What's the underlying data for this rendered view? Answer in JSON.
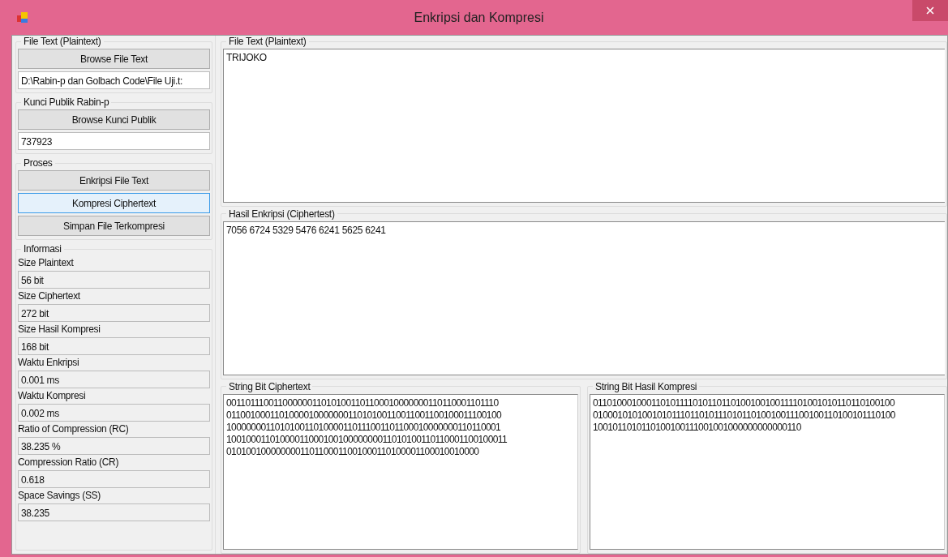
{
  "window": {
    "title": "Enkripsi dan Kompresi"
  },
  "left": {
    "file_group": {
      "title": "File Text (Plaintext)",
      "button": "Browse File Text",
      "path": "D:\\Rabin-p dan Golbach Code\\File Uji.t:"
    },
    "key_group": {
      "title": "Kunci Publik Rabin-p",
      "button": "Browse Kunci Publik",
      "value": "737923"
    },
    "process_group": {
      "title": "Proses",
      "buttons": [
        {
          "label": "Enkripsi File Text",
          "focused": false
        },
        {
          "label": "Kompresi Ciphertext",
          "focused": true
        },
        {
          "label": "Simpan File Terkompresi",
          "focused": false
        }
      ]
    },
    "info_group": {
      "title": "Informasi",
      "fields": [
        {
          "label": "Size Plaintext",
          "value": "56 bit"
        },
        {
          "label": "Size Ciphertext",
          "value": "272 bit"
        },
        {
          "label": "Size Hasil Kompresi",
          "value": "168 bit"
        },
        {
          "label": "Waktu Enkripsi",
          "value": "0.001 ms"
        },
        {
          "label": "Waktu Kompresi",
          "value": "0.002 ms"
        },
        {
          "label": "Ratio of Compression (RC)",
          "value": "38.235 %"
        },
        {
          "label": "Compression Ratio (CR)",
          "value": "0.618"
        },
        {
          "label": "Space Savings (SS)",
          "value": "38.235"
        }
      ]
    }
  },
  "plaintext": {
    "title": "File Text (Plaintext)",
    "text": "TRIJOKO"
  },
  "ciphertext": {
    "title": "Hasil Enkripsi (Ciphertest)",
    "text": "7056 6724 5329 5476 6241 5625 6241"
  },
  "bit_cipher": {
    "title": "String Bit Ciphertext",
    "lines": [
      "001101110011000000110101001101100010000000110110001101110",
      "011001000110100001000000011010100110011001100100011100100",
      "100000001101010011010000110111001101100010000000110110001",
      "1001000110100001100010010000000011010100110110001100100011",
      "0101001000000001101100011001000110100001100010010000"
    ]
  },
  "bit_compressed": {
    "title": "String Bit Hasil Kompresi",
    "lines": [
      "011010001000110101111010110110100100100111101001010110110100100",
      "010001010100101011101101011101011010010011100100110100101110100",
      "1001011010110100100111001001000000000000110"
    ]
  }
}
